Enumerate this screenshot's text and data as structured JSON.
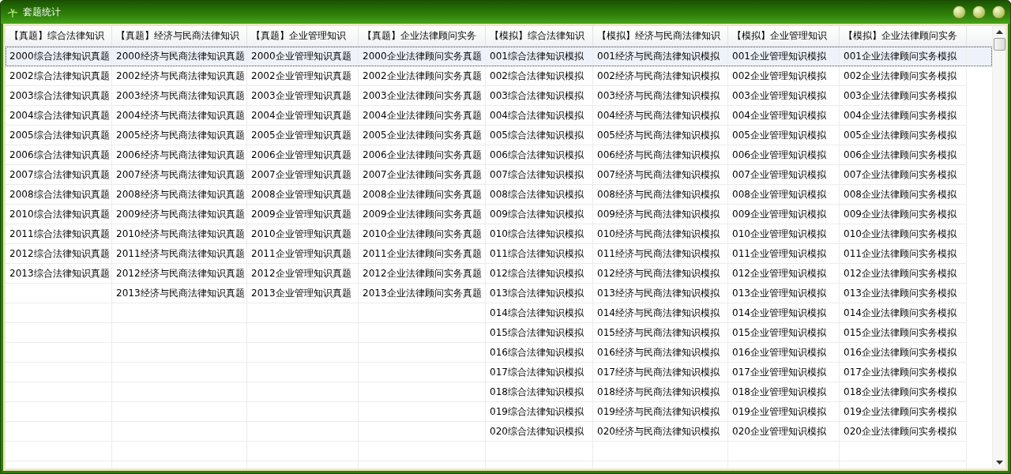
{
  "window": {
    "title": "套题统计"
  },
  "table": {
    "columns": [
      "【真题】综合法律知识",
      "【真题】经济与民商法律知识",
      "【真题】企业管理知识",
      "【真题】企业法律顾问实务",
      "【模拟】综合法律知识",
      "【模拟】经济与民商法律知识",
      "【模拟】企业管理知识",
      "【模拟】企业法律顾问实务"
    ],
    "rows": [
      {
        "selected": true,
        "cells": [
          "2000综合法律知识真题",
          "2000经济与民商法律知识真题",
          "2000企业管理知识真题",
          "2000企业法律顾问实务真题",
          "001综合法律知识模拟",
          "001经济与民商法律知识模拟",
          "001企业管理知识模拟",
          "001企业法律顾问实务模拟"
        ]
      },
      {
        "selected": false,
        "cells": [
          "2002综合法律知识真题",
          "2002经济与民商法律知识真题",
          "2002企业管理知识真题",
          "2002企业法律顾问实务真题",
          "002综合法律知识模拟",
          "002经济与民商法律知识模拟",
          "002企业管理知识模拟",
          "002企业法律顾问实务模拟"
        ]
      },
      {
        "selected": false,
        "cells": [
          "2003综合法律知识真题",
          "2003经济与民商法律知识真题",
          "2003企业管理知识真题",
          "2003企业法律顾问实务真题",
          "003综合法律知识模拟",
          "003经济与民商法律知识模拟",
          "003企业管理知识模拟",
          "003企业法律顾问实务模拟"
        ]
      },
      {
        "selected": false,
        "cells": [
          "2004综合法律知识真题",
          "2004经济与民商法律知识真题",
          "2004企业管理知识真题",
          "2004企业法律顾问实务真题",
          "004综合法律知识模拟",
          "004经济与民商法律知识模拟",
          "004企业管理知识模拟",
          "004企业法律顾问实务模拟"
        ]
      },
      {
        "selected": false,
        "cells": [
          "2005综合法律知识真题",
          "2005经济与民商法律知识真题",
          "2005企业管理知识真题",
          "2005企业法律顾问实务真题",
          "005综合法律知识模拟",
          "005经济与民商法律知识模拟",
          "005企业管理知识模拟",
          "005企业法律顾问实务模拟"
        ]
      },
      {
        "selected": false,
        "cells": [
          "2006综合法律知识真题",
          "2006经济与民商法律知识真题",
          "2006企业管理知识真题",
          "2006企业法律顾问实务真题",
          "006综合法律知识模拟",
          "006经济与民商法律知识模拟",
          "006企业管理知识模拟",
          "006企业法律顾问实务模拟"
        ]
      },
      {
        "selected": false,
        "cells": [
          "2007综合法律知识真题",
          "2007经济与民商法律知识真题",
          "2007企业管理知识真题",
          "2007企业法律顾问实务真题",
          "007综合法律知识模拟",
          "007经济与民商法律知识模拟",
          "007企业管理知识模拟",
          "007企业法律顾问实务模拟"
        ]
      },
      {
        "selected": false,
        "cells": [
          "2008综合法律知识真题",
          "2008经济与民商法律知识真题",
          "2008企业管理知识真题",
          "2008企业法律顾问实务真题",
          "008综合法律知识模拟",
          "008经济与民商法律知识模拟",
          "008企业管理知识模拟",
          "008企业法律顾问实务模拟"
        ]
      },
      {
        "selected": false,
        "cells": [
          "2010综合法律知识真题",
          "2009经济与民商法律知识真题",
          "2009企业管理知识真题",
          "2009企业法律顾问实务真题",
          "009综合法律知识模拟",
          "009经济与民商法律知识模拟",
          "009企业管理知识模拟",
          "009企业法律顾问实务模拟"
        ]
      },
      {
        "selected": false,
        "cells": [
          "2011综合法律知识真题",
          "2010经济与民商法律知识真题",
          "2010企业管理知识真题",
          "2010企业法律顾问实务真题",
          "010综合法律知识模拟",
          "010经济与民商法律知识模拟",
          "010企业管理知识模拟",
          "010企业法律顾问实务模拟"
        ]
      },
      {
        "selected": false,
        "cells": [
          "2012综合法律知识真题",
          "2011经济与民商法律知识真题",
          "2011企业管理知识真题",
          "2011企业法律顾问实务真题",
          "011综合法律知识模拟",
          "011经济与民商法律知识模拟",
          "011企业管理知识模拟",
          "011企业法律顾问实务模拟"
        ]
      },
      {
        "selected": false,
        "cells": [
          "2013综合法律知识真题",
          "2012经济与民商法律知识真题",
          "2012企业管理知识真题",
          "2012企业法律顾问实务真题",
          "012综合法律知识模拟",
          "012经济与民商法律知识模拟",
          "012企业管理知识模拟",
          "012企业法律顾问实务模拟"
        ]
      },
      {
        "selected": false,
        "cells": [
          null,
          "2013经济与民商法律知识真题",
          "2013企业管理知识真题",
          "2013企业法律顾问实务真题",
          "013综合法律知识模拟",
          "013经济与民商法律知识模拟",
          "013企业管理知识模拟",
          "013企业法律顾问实务模拟"
        ]
      },
      {
        "selected": false,
        "cells": [
          null,
          null,
          null,
          null,
          "014综合法律知识模拟",
          "014经济与民商法律知识模拟",
          "014企业管理知识模拟",
          "014企业法律顾问实务模拟"
        ]
      },
      {
        "selected": false,
        "cells": [
          null,
          null,
          null,
          null,
          "015综合法律知识模拟",
          "015经济与民商法律知识模拟",
          "015企业管理知识模拟",
          "015企业法律顾问实务模拟"
        ]
      },
      {
        "selected": false,
        "cells": [
          null,
          null,
          null,
          null,
          "016综合法律知识模拟",
          "016经济与民商法律知识模拟",
          "016企业管理知识模拟",
          "016企业法律顾问实务模拟"
        ]
      },
      {
        "selected": false,
        "cells": [
          null,
          null,
          null,
          null,
          "017综合法律知识模拟",
          "017经济与民商法律知识模拟",
          "017企业管理知识模拟",
          "017企业法律顾问实务模拟"
        ]
      },
      {
        "selected": false,
        "cells": [
          null,
          null,
          null,
          null,
          "018综合法律知识模拟",
          "018经济与民商法律知识模拟",
          "018企业管理知识模拟",
          "018企业法律顾问实务模拟"
        ]
      },
      {
        "selected": false,
        "cells": [
          null,
          null,
          null,
          null,
          "019综合法律知识模拟",
          "019经济与民商法律知识模拟",
          "019企业管理知识模拟",
          "019企业法律顾问实务模拟"
        ]
      },
      {
        "selected": false,
        "cells": [
          null,
          null,
          null,
          null,
          "020综合法律知识模拟",
          "020经济与民商法律知识模拟",
          "020企业管理知识模拟",
          "020企业法律顾问实务模拟"
        ]
      }
    ]
  }
}
